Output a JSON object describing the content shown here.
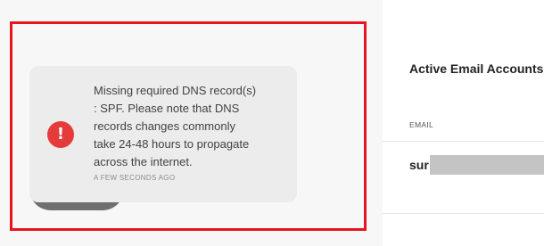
{
  "toast": {
    "icon": "error-exclamation-icon",
    "message": "Missing required DNS record(s)\n: SPF. Please note that DNS\nrecords changes commonly\ntake 24-48 hours to propagate\nacross the internet.",
    "timestamp": "A FEW SECONDS AGO"
  },
  "accounts": {
    "title": "Active Email Accounts",
    "column_email": "EMAIL",
    "rows": [
      {
        "email": "sur"
      }
    ]
  },
  "colors": {
    "highlight": "#e8141f",
    "error": "#e53b3b",
    "toast_bg": "#ececec"
  }
}
